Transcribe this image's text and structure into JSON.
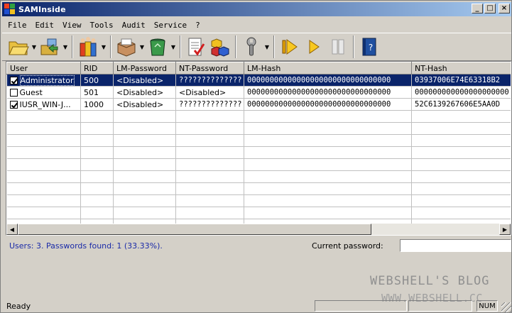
{
  "window": {
    "title": "SAMInside",
    "buttons": {
      "minimize": "_",
      "maximize": "□",
      "close": "×"
    }
  },
  "menu": [
    "File",
    "Edit",
    "View",
    "Tools",
    "Audit",
    "Service",
    "?"
  ],
  "toolbar": {
    "icons": [
      "open-folder-icon",
      "import-icon",
      "users-icon",
      "export-box-icon",
      "recycle-bin-icon",
      "checklist-icon",
      "cubes-icon",
      "wrench-icon",
      "play-icon",
      "resume-icon",
      "pause-icon",
      "help-book-icon"
    ]
  },
  "table": {
    "columns": [
      "User",
      "RID",
      "LM-Password",
      "NT-Password",
      "LM-Hash",
      "NT-Hash"
    ],
    "rows": [
      {
        "checked": true,
        "user": "Administrator",
        "rid": "500",
        "lm_password": "<Disabled>",
        "nt_password": "??????????????",
        "lm_hash": "00000000000000000000000000000000",
        "nt_hash": "03937006E74E63318B2",
        "selected": true
      },
      {
        "checked": false,
        "user": "Guest",
        "rid": "501",
        "lm_password": "<Disabled>",
        "nt_password": "<Disabled>",
        "lm_hash": "00000000000000000000000000000000",
        "nt_hash": "000000000000000000000",
        "selected": false
      },
      {
        "checked": true,
        "user": "IUSR_WIN-J...",
        "rid": "1000",
        "lm_password": "<Disabled>",
        "nt_password": "??????????????",
        "lm_hash": "00000000000000000000000000000000",
        "nt_hash": "52C6139267606E5AA0D",
        "selected": false
      }
    ]
  },
  "info": {
    "summary": "Users: 3. Passwords found: 1 (33.33%).",
    "current_password_label": "Current password:",
    "current_password_value": ""
  },
  "watermark": {
    "line1": "WEBSHELL'S BLOG",
    "line2": "WWW.WEBSHELL.CC"
  },
  "status": {
    "text": "Ready",
    "num": "NUM"
  },
  "colors": {
    "selection": "#0a246a",
    "info_text": "#1a2aa8"
  }
}
